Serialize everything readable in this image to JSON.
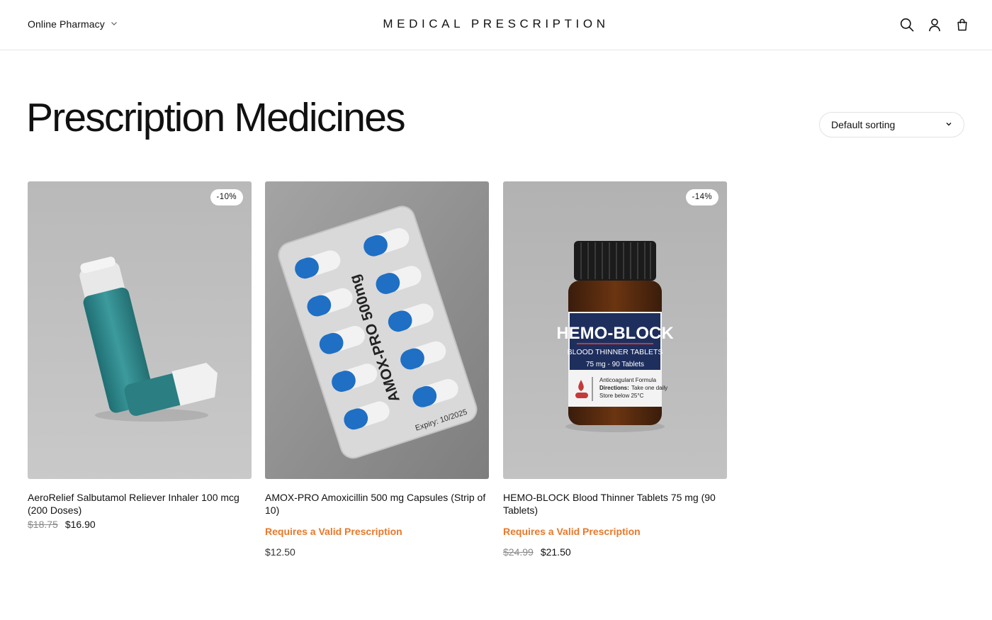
{
  "header": {
    "menu_label": "Online Pharmacy",
    "site_title": "MEDICAL PRESCRIPTION",
    "icons": [
      "search-icon",
      "account-icon",
      "cart-icon"
    ]
  },
  "page": {
    "title": "Prescription Medicines",
    "sorting": {
      "selected": "Default sorting"
    }
  },
  "products": [
    {
      "name": "AeroRelief Salbutamol Reliever Inhaler 100 mcg (200 Doses)",
      "badge": "-10%",
      "price_old": "$18.75",
      "price": "$16.90",
      "image": {
        "type": "inhaler",
        "color": "#2e8a8e"
      }
    },
    {
      "name": "AMOX-PRO Amoxicillin 500 mg Capsules (Strip of 10)",
      "rx_note": "Requires a Valid Prescription",
      "price": "$12.50",
      "image": {
        "type": "blister-pack",
        "label": "AMOX-PRO 500mg",
        "expiry": "Expiry: 10/2025",
        "color": "#1f6fc4"
      }
    },
    {
      "name": "HEMO-BLOCK Blood Thinner Tablets 75 mg (90 Tablets)",
      "badge": "-14%",
      "rx_note": "Requires a Valid Prescription",
      "price_old": "$24.99",
      "price": "$21.50",
      "image": {
        "type": "pill-bottle",
        "brand": "HEMO-BLOCK",
        "subtitle": "BLOOD THINNER TABLETS",
        "dose": "75 mg - 90 Tablets",
        "line1": "Anticoagulant Formula",
        "line2_bold": "Directions:",
        "line2": "Take one daily",
        "line3": "Store below 25°C",
        "color": "#1e2f5e"
      }
    }
  ],
  "colors": {
    "accent": "#e8782a",
    "text": "#111111",
    "muted": "#8a8a8a"
  }
}
